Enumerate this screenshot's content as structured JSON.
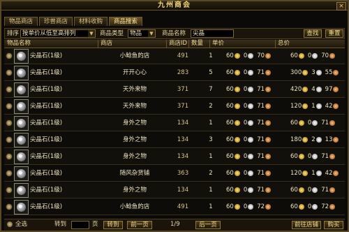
{
  "window": {
    "title": "九州商会",
    "close_label": "×"
  },
  "tabs": [
    {
      "label": "物品商店",
      "active": false
    },
    {
      "label": "珍兽商店",
      "active": false
    },
    {
      "label": "材料收购",
      "active": false
    },
    {
      "label": "商品搜索",
      "active": true
    }
  ],
  "filter": {
    "sort_label": "排序",
    "sort_value": "按单价从低至高排列",
    "type_label": "商品类型",
    "type_value": "物品",
    "name_label": "商品名称",
    "name_value": "尖晶",
    "search_button": "查找",
    "reset_button": "重置"
  },
  "columns": [
    "物品名称",
    "商店",
    "商店ID",
    "数量",
    "单价",
    "总价"
  ],
  "rows": [
    {
      "name": "尖晶石(1级)",
      "shop": "小鲶鱼的店",
      "shop_id": "491",
      "qty": "1",
      "unit": {
        "gold": "60",
        "silver": "0",
        "copper": "70"
      },
      "total": {
        "gold": "60",
        "silver": "0",
        "copper": "70"
      }
    },
    {
      "name": "尖晶石(1级)",
      "shop": "开开心心",
      "shop_id": "283",
      "qty": "5",
      "unit": {
        "gold": "60",
        "silver": "0",
        "copper": "71"
      },
      "total": {
        "gold": "300",
        "silver": "3",
        "copper": "55"
      }
    },
    {
      "name": "尖晶石(1级)",
      "shop": "天外来物",
      "shop_id": "371",
      "qty": "7",
      "unit": {
        "gold": "60",
        "silver": "0",
        "copper": "71"
      },
      "total": {
        "gold": "420",
        "silver": "4",
        "copper": "97"
      }
    },
    {
      "name": "尖晶石(1级)",
      "shop": "天外来物",
      "shop_id": "371",
      "qty": "2",
      "unit": {
        "gold": "60",
        "silver": "0",
        "copper": "71"
      },
      "total": {
        "gold": "120",
        "silver": "1",
        "copper": "42"
      }
    },
    {
      "name": "尖晶石(1级)",
      "shop": "身外之物",
      "shop_id": "134",
      "qty": "1",
      "unit": {
        "gold": "60",
        "silver": "0",
        "copper": "71"
      },
      "total": {
        "gold": "60",
        "silver": "0",
        "copper": "71"
      }
    },
    {
      "name": "尖晶石(1级)",
      "shop": "身外之物",
      "shop_id": "134",
      "qty": "3",
      "unit": {
        "gold": "60",
        "silver": "0",
        "copper": "71"
      },
      "total": {
        "gold": "180",
        "silver": "2",
        "copper": "13"
      }
    },
    {
      "name": "尖晶石(1级)",
      "shop": "身外之物",
      "shop_id": "134",
      "qty": "1",
      "unit": {
        "gold": "60",
        "silver": "0",
        "copper": "71"
      },
      "total": {
        "gold": "60",
        "silver": "0",
        "copper": "71"
      }
    },
    {
      "name": "尖晶石(1级)",
      "shop": "随风杂货铺",
      "shop_id": "363",
      "qty": "2",
      "unit": {
        "gold": "60",
        "silver": "0",
        "copper": "71"
      },
      "total": {
        "gold": "120",
        "silver": "1",
        "copper": "42"
      }
    },
    {
      "name": "尖晶石(1级)",
      "shop": "身外之物",
      "shop_id": "134",
      "qty": "1",
      "unit": {
        "gold": "60",
        "silver": "0",
        "copper": "71"
      },
      "total": {
        "gold": "60",
        "silver": "0",
        "copper": "71"
      }
    },
    {
      "name": "尖晶石(1级)",
      "shop": "小鲶鱼的店",
      "shop_id": "491",
      "qty": "1",
      "unit": {
        "gold": "60",
        "silver": "0",
        "copper": "72"
      },
      "total": {
        "gold": "60",
        "silver": "0",
        "copper": "72"
      }
    }
  ],
  "footer": {
    "select_all": "全选",
    "goto_label": "转到",
    "page_unit": "页",
    "goto_button": "转到",
    "prev_button": "前一页",
    "page_indicator": "1/9",
    "next_button": "后一页",
    "shop_button": "前往店铺",
    "buy_button": "购买"
  }
}
